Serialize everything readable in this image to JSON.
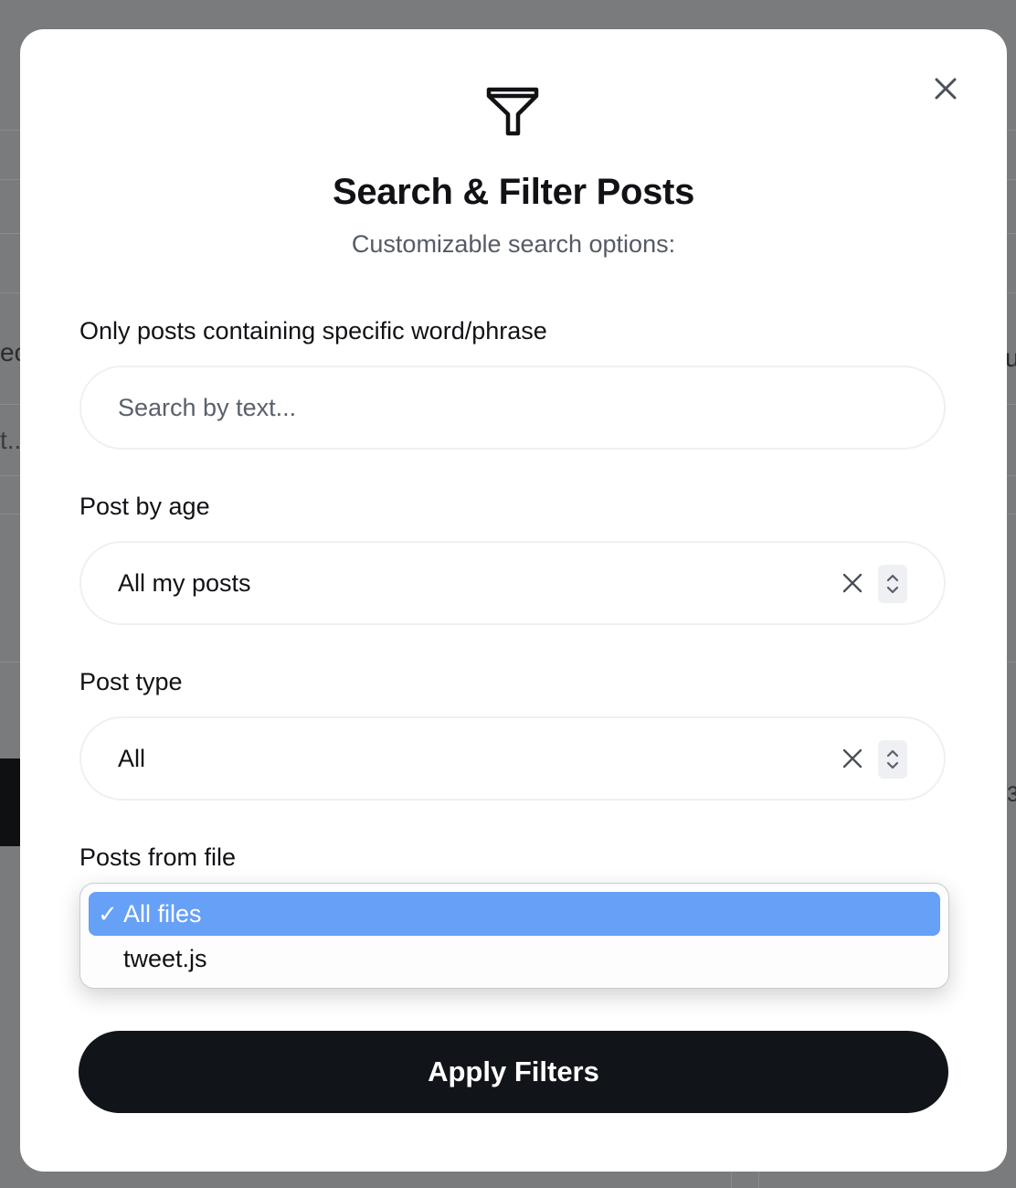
{
  "background": {
    "fragments": [
      "ec",
      "t..",
      "u",
      "3"
    ]
  },
  "modal": {
    "title": "Search & Filter Posts",
    "subtitle": "Customizable search options:",
    "close_icon": "close-icon",
    "header_icon": "funnel-icon"
  },
  "fields": {
    "text_search": {
      "label": "Only posts containing specific word/phrase",
      "value": "",
      "placeholder": "Search by text..."
    },
    "post_age": {
      "label": "Post by age",
      "value": "All my posts"
    },
    "post_type": {
      "label": "Post type",
      "value": "All"
    },
    "posts_from_file": {
      "label": "Posts from file",
      "options": [
        {
          "label": "All files",
          "selected": true
        },
        {
          "label": "tweet.js",
          "selected": false
        }
      ],
      "checkmark": "✓"
    }
  },
  "actions": {
    "apply_label": "Apply Filters"
  },
  "colors": {
    "overlay": "#7d7e80",
    "primary_button": "#111419",
    "selected_option": "#66a0f7",
    "muted_text": "#555b66"
  }
}
